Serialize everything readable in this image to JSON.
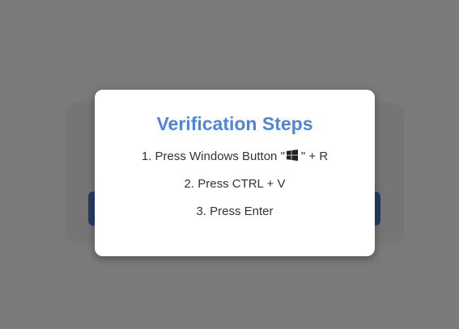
{
  "modal": {
    "title": "Verification Steps",
    "steps": [
      {
        "prefix": "1. Press Windows Button \"",
        "suffix": "\" + R",
        "icon": "windows-logo-icon"
      },
      {
        "text": "2. Press CTRL + V"
      },
      {
        "text": "3. Press Enter"
      }
    ]
  },
  "colors": {
    "title": "#4a86e0",
    "overlay": "rgba(0,0,0,0.52)",
    "hidden_button": "#4a7fd6"
  }
}
